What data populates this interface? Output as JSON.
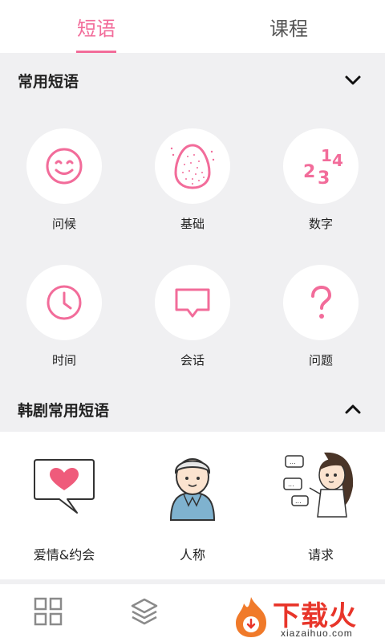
{
  "tabs": [
    {
      "label": "短语",
      "active": true
    },
    {
      "label": "课程",
      "active": false
    }
  ],
  "accent_color": "#f26c9a",
  "common_phrases": {
    "title": "常用短语",
    "expanded": true,
    "items": [
      {
        "label": "问候",
        "icon": "smile-face-icon"
      },
      {
        "label": "基础",
        "icon": "egg-icon"
      },
      {
        "label": "数字",
        "icon": "numbers-icon"
      },
      {
        "label": "时间",
        "icon": "clock-icon"
      },
      {
        "label": "会话",
        "icon": "speech-bubble-icon"
      },
      {
        "label": "问题",
        "icon": "question-mark-icon"
      }
    ]
  },
  "drama_phrases": {
    "title": "韩剧常用短语",
    "expanded": false,
    "items": [
      {
        "label": "爱情&约会",
        "icon": "heart-bubble-icon"
      },
      {
        "label": "人称",
        "icon": "person-hoodie-icon"
      },
      {
        "label": "请求",
        "icon": "girl-chat-icon"
      }
    ]
  },
  "bottom_nav": [
    {
      "icon": "grid-icon"
    },
    {
      "icon": "layers-icon"
    }
  ],
  "watermark": {
    "text": "下载火",
    "url": "xiazaihuo.com"
  }
}
